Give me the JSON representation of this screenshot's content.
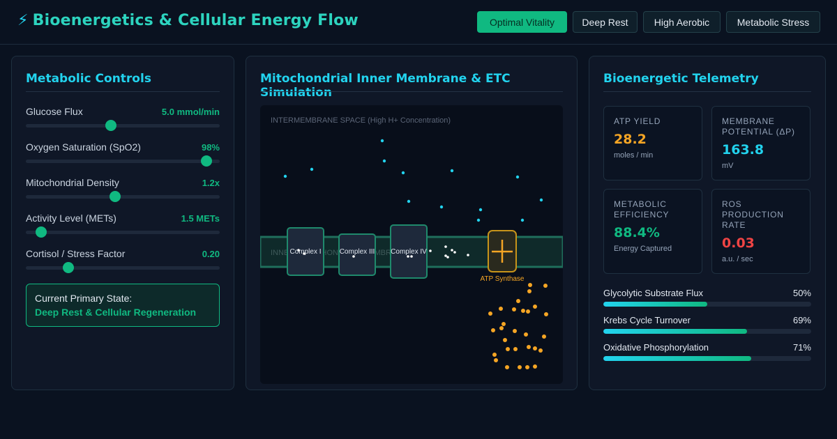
{
  "header": {
    "title": "Bioenergetics & Cellular Energy Flow",
    "bolt_icon": "⚡",
    "scenarios": [
      "Optimal Vitality",
      "Deep Rest",
      "High Aerobic",
      "Metabolic Stress"
    ],
    "active_scenario": "Optimal Vitality"
  },
  "controls": {
    "title": "Metabolic Controls",
    "sliders": [
      {
        "label": "Glucose Flux",
        "value": "5.0 mmol/min",
        "level": 0.44
      },
      {
        "label": "Oxygen Saturation (SpO2)",
        "value": "98%",
        "level": 0.93
      },
      {
        "label": "Mitochondrial Density",
        "value": "1.2x",
        "level": 0.46
      },
      {
        "label": "Activity Level (METs)",
        "value": "1.5 METs",
        "level": 0.08
      },
      {
        "label": "Cortisol / Stress Factor",
        "value": "0.20",
        "level": 0.22
      }
    ],
    "state_caption": "Current Primary State:",
    "state_value": "Deep Rest & Cellular Regeneration"
  },
  "simulation": {
    "title": "Mitochondrial Inner Membrane & ETC Simulation",
    "ims_label": "INTERMEMBRANE SPACE (High H+ Concentration)",
    "membrane_label": "INNER MITOCHONDRIAL MEMBRANE",
    "complexes": [
      "Complex I",
      "Complex III",
      "Complex IV"
    ],
    "atp_synthase_label": "ATP Synthase"
  },
  "telemetry": {
    "title": "Bioenergetic Telemetry",
    "metrics": [
      {
        "label": "ATP YIELD",
        "value": "28.2",
        "unit": "moles / min",
        "color": "#f5a524"
      },
      {
        "label": "MEMBRANE POTENTIAL (ΔP)",
        "value": "163.8",
        "unit": "mV",
        "color": "#22d3ee"
      },
      {
        "label": "METABOLIC EFFICIENCY",
        "value": "88.4%",
        "unit": "Energy Captured",
        "color": "#10b981"
      },
      {
        "label": "ROS PRODUCTION RATE",
        "value": "0.03",
        "unit": "a.u. / sec",
        "color": "#ef4444"
      }
    ],
    "bars": [
      {
        "label": "Glycolytic Substrate Flux",
        "pct": "50%",
        "level": 0.5
      },
      {
        "label": "Krebs Cycle Turnover",
        "pct": "69%",
        "level": 0.69
      },
      {
        "label": "Oxidative Phosphorylation",
        "pct": "71%",
        "level": 0.71
      }
    ]
  }
}
